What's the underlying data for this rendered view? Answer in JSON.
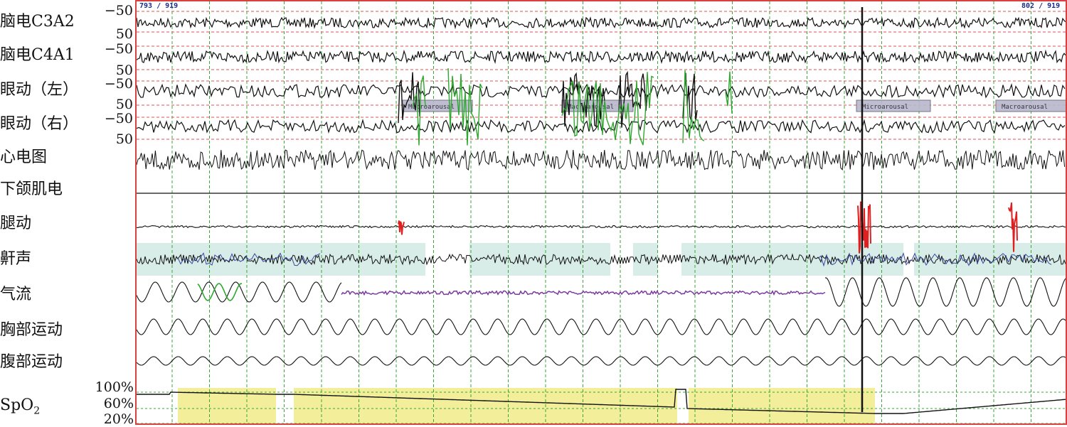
{
  "channels": [
    {
      "key": "c3a2",
      "label": "脑电C3A2",
      "scale_top": "−50",
      "scale_bottom": "50"
    },
    {
      "key": "c4a1",
      "label": "脑电C4A1",
      "scale_top": "−50",
      "scale_bottom": "50"
    },
    {
      "key": "eogl",
      "label": "眼动（左）",
      "scale_top": "−50",
      "scale_bottom": "50"
    },
    {
      "key": "eogr",
      "label": "眼动（右）",
      "scale_top": "−50",
      "scale_bottom": "50"
    },
    {
      "key": "ecg",
      "label": "心电图"
    },
    {
      "key": "emg",
      "label": "下颌肌电"
    },
    {
      "key": "leg",
      "label": "腿动"
    },
    {
      "key": "snore",
      "label": "鼾声"
    },
    {
      "key": "airflow",
      "label": "气流"
    },
    {
      "key": "chest",
      "label": "胸部运动"
    },
    {
      "key": "abdomen",
      "label": "腹部运动"
    }
  ],
  "spo2": {
    "label_main": "SpO",
    "label_sub": "2",
    "ticks": [
      "100%",
      "60%",
      "20%"
    ]
  },
  "hud": {
    "left": "793 / 919",
    "right": "802 / 919"
  },
  "events": {
    "macroarousal": "Macroarousal",
    "microarousal": "Microarousal"
  },
  "colors": {
    "border": "#d94040",
    "grid_red": "#e05050",
    "grid_green": "#3aa63a",
    "spo2_band": "#f3ee9a",
    "snore_band": "#cfe8e2",
    "event_box": "#b8b8cc",
    "green": "#2ea82e",
    "purple": "#7a3aa0",
    "red": "#e02020",
    "blue": "#3a4aa0"
  }
}
